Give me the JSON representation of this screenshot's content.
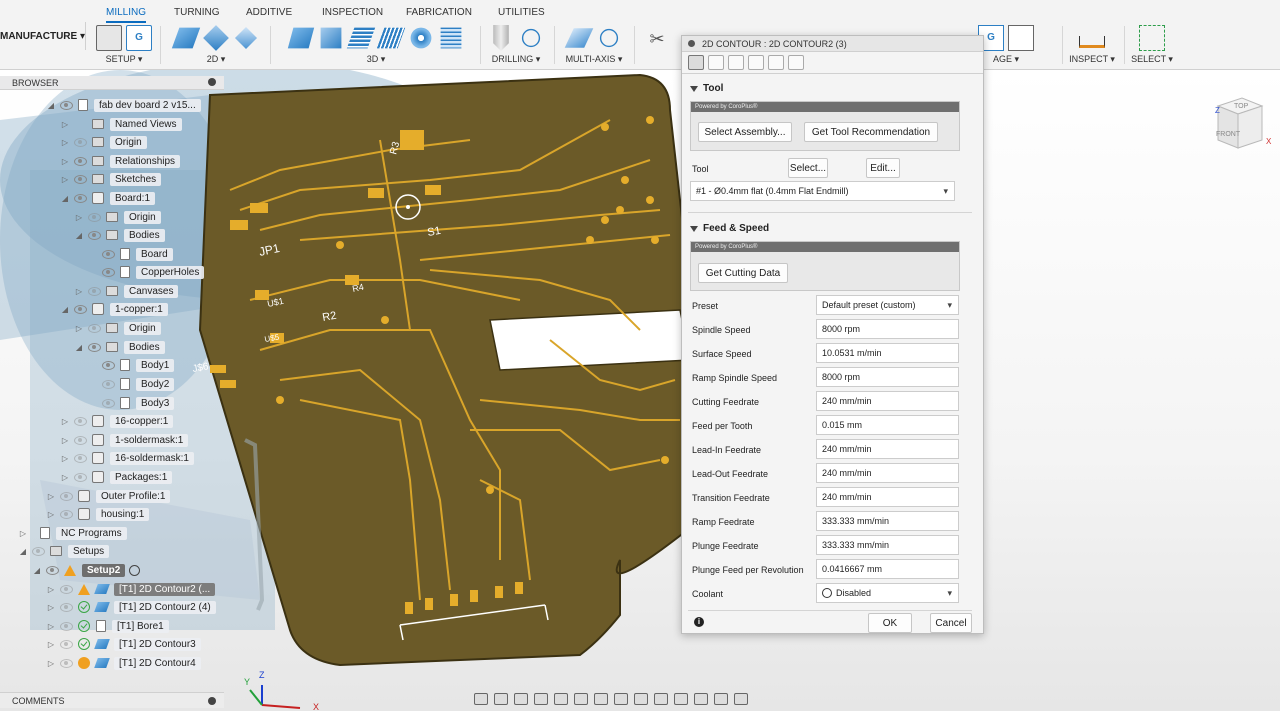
{
  "workspace": "MANUFACTURE",
  "tabs": [
    "MILLING",
    "TURNING",
    "ADDITIVE",
    "INSPECTION",
    "FABRICATION",
    "UTILITIES"
  ],
  "active_tab": "MILLING",
  "groups": {
    "setup": "SETUP ▾",
    "twod": "2D ▾",
    "threed": "3D ▾",
    "drilling": "DRILLING ▾",
    "multiaxis": "MULTI-AXIS ▾",
    "manage": "AGE ▾",
    "inspect": "INSPECT ▾",
    "select": "SELECT ▾"
  },
  "browser": {
    "title": "BROWSER",
    "items": [
      {
        "label": "fab dev board 2 v15...",
        "expanded": true
      },
      {
        "label": "Named Views"
      },
      {
        "label": "Origin"
      },
      {
        "label": "Relationships"
      },
      {
        "label": "Sketches"
      },
      {
        "label": "Board:1"
      },
      {
        "label": "Origin"
      },
      {
        "label": "Bodies"
      },
      {
        "label": "Board"
      },
      {
        "label": "CopperHoles"
      },
      {
        "label": "Canvases"
      },
      {
        "label": "1-copper:1"
      },
      {
        "label": "Origin"
      },
      {
        "label": "Bodies"
      },
      {
        "label": "Body1"
      },
      {
        "label": "Body2"
      },
      {
        "label": "Body3"
      },
      {
        "label": "16-copper:1"
      },
      {
        "label": "1-soldermask:1"
      },
      {
        "label": "16-soldermask:1"
      },
      {
        "label": "Packages:1"
      },
      {
        "label": "Outer Profile:1"
      },
      {
        "label": "housing:1"
      },
      {
        "label": "NC Programs"
      },
      {
        "label": "Setups"
      },
      {
        "label": "Setup2"
      },
      {
        "label": "[T1] 2D Contour2 (..."
      },
      {
        "label": "[T1] 2D Contour2 (4)"
      },
      {
        "label": "[T1] Bore1"
      },
      {
        "label": "[T1] 2D Contour3"
      },
      {
        "label": "[T1] 2D Contour4"
      }
    ]
  },
  "comments": "COMMENTS",
  "pcb_labels": {
    "r3": "R3",
    "s1": "S1",
    "jp1": "JP1",
    "r4": "R4",
    "us1": "U$1",
    "r2": "R2",
    "us5": "U$5",
    "js6": "J$6"
  },
  "navcube": {
    "top": "TOP",
    "front": "FRONT",
    "axis_z": "Z",
    "axis_x": "X"
  },
  "triad": {
    "z": "Z",
    "x": "X",
    "y": "Y"
  },
  "dialog": {
    "title": "2D CONTOUR : 2D CONTOUR2 (3)",
    "tool_section": "Tool",
    "powered": "Powered by CoroPlus®",
    "select_assembly": "Select Assembly...",
    "get_tool_rec": "Get Tool Recommendation",
    "tool_label": "Tool",
    "select_btn": "Select...",
    "edit_btn": "Edit...",
    "tool_value": "#1 - Ø0.4mm flat (0.4mm Flat Endmill)",
    "feed_section": "Feed & Speed",
    "get_cutting": "Get Cutting Data",
    "fields": [
      {
        "label": "Preset",
        "value": "Default preset (custom)"
      },
      {
        "label": "Spindle Speed",
        "value": "8000 rpm"
      },
      {
        "label": "Surface Speed",
        "value": "10.0531 m/min"
      },
      {
        "label": "Ramp Spindle Speed",
        "value": "8000 rpm"
      },
      {
        "label": "Cutting Feedrate",
        "value": "240 mm/min"
      },
      {
        "label": "Feed per Tooth",
        "value": "0.015 mm"
      },
      {
        "label": "Lead-In Feedrate",
        "value": "240 mm/min"
      },
      {
        "label": "Lead-Out Feedrate",
        "value": "240 mm/min"
      },
      {
        "label": "Transition Feedrate",
        "value": "240 mm/min"
      },
      {
        "label": "Ramp Feedrate",
        "value": "333.333 mm/min"
      },
      {
        "label": "Plunge Feedrate",
        "value": "333.333 mm/min"
      },
      {
        "label": "Plunge Feed per Revolution",
        "value": "0.0416667 mm"
      },
      {
        "label": "Coolant",
        "value": "Disabled"
      }
    ],
    "ok": "OK",
    "cancel": "Cancel",
    "info": "i"
  }
}
